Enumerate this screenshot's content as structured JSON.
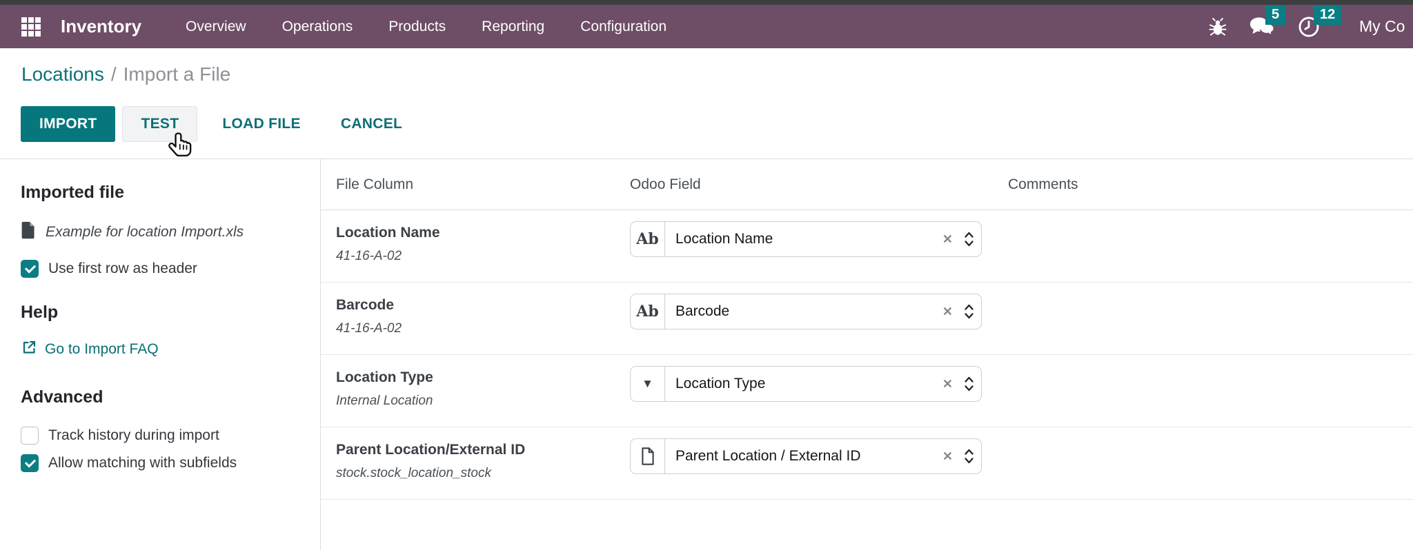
{
  "navbar": {
    "app_name": "Inventory",
    "menu_items": [
      "Overview",
      "Operations",
      "Products",
      "Reporting",
      "Configuration"
    ],
    "messages_badge": "5",
    "activities_badge": "12",
    "company": "My Co",
    "colors": {
      "bg": "#6e4d67",
      "badge": "#0b7e84"
    }
  },
  "breadcrumb": {
    "parent": "Locations",
    "separator": "/",
    "current": "Import a File"
  },
  "toolbar": {
    "import_label": "IMPORT",
    "test_label": "TEST",
    "load_file_label": "LOAD FILE",
    "cancel_label": "CANCEL",
    "accent_color": "#06777d"
  },
  "sidebar": {
    "imported_file": {
      "heading": "Imported file",
      "file_name": "Example for location Import.xls",
      "use_first_row": {
        "label": "Use first row as header",
        "checked": true
      }
    },
    "help": {
      "heading": "Help",
      "faq_link": "Go to Import FAQ"
    },
    "advanced": {
      "heading": "Advanced",
      "options": [
        {
          "label": "Track history during import",
          "checked": false
        },
        {
          "label": "Allow matching with subfields",
          "checked": true
        }
      ]
    }
  },
  "table": {
    "headers": {
      "file_column": "File Column",
      "odoo_field": "Odoo Field",
      "comments": "Comments"
    },
    "rows": [
      {
        "file_column": "Location Name",
        "sample": "41-16-A-02",
        "field_type": "char",
        "type_glyph": "Ab",
        "odoo_field": "Location Name",
        "comment": ""
      },
      {
        "file_column": "Barcode",
        "sample": "41-16-A-02",
        "field_type": "char",
        "type_glyph": "Ab",
        "odoo_field": "Barcode",
        "comment": ""
      },
      {
        "file_column": "Location Type",
        "sample": "Internal Location",
        "field_type": "selection",
        "type_glyph": "▼",
        "odoo_field": "Location Type",
        "comment": ""
      },
      {
        "file_column": "Parent Location/External ID",
        "sample": "stock.stock_location_stock",
        "field_type": "many2one",
        "type_glyph": "",
        "odoo_field": "Parent Location / External ID",
        "comment": ""
      }
    ]
  }
}
